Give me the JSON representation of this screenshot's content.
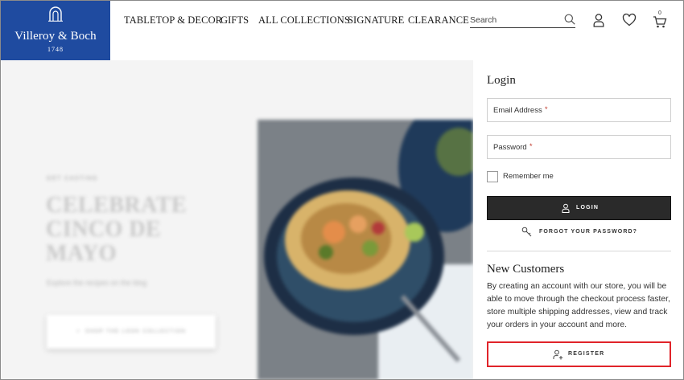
{
  "header": {
    "logo": {
      "brand": "Villeroy & Boch",
      "year": "1748",
      "bg_color": "#1f4ba0"
    },
    "nav": [
      "TABLETOP & DECOR",
      "GIFTS",
      "ALL COLLECTIONS",
      "SIGNATURE",
      "CLEARANCE"
    ],
    "search": {
      "placeholder": "Search",
      "icon": "search-icon"
    },
    "icons": [
      "account-icon",
      "wishlist-heart-icon",
      "cart-icon"
    ],
    "cart_count": "0"
  },
  "hero": {
    "kicker": "GET CASTING",
    "headline": "CELEBRATE CINCO DE MAYO",
    "subtext": "Explore the recipes on the blog",
    "cta": "SHOP THE LOOK COLLECTION"
  },
  "login": {
    "title": "Login",
    "email_placeholder": "Email Address",
    "password_placeholder": "Password",
    "required_mark": "*",
    "remember_label": "Remember me",
    "login_button": "LOGIN",
    "forgot_link": "FORGOT YOUR PASSWORD?"
  },
  "new_customers": {
    "title": "New Customers",
    "description": "By creating an account with our store, you will be able to move through the checkout process faster, store multiple shipping addresses, view and track your orders in your account and more.",
    "register_button": "REGISTER",
    "highlight_color": "#e0242a"
  }
}
